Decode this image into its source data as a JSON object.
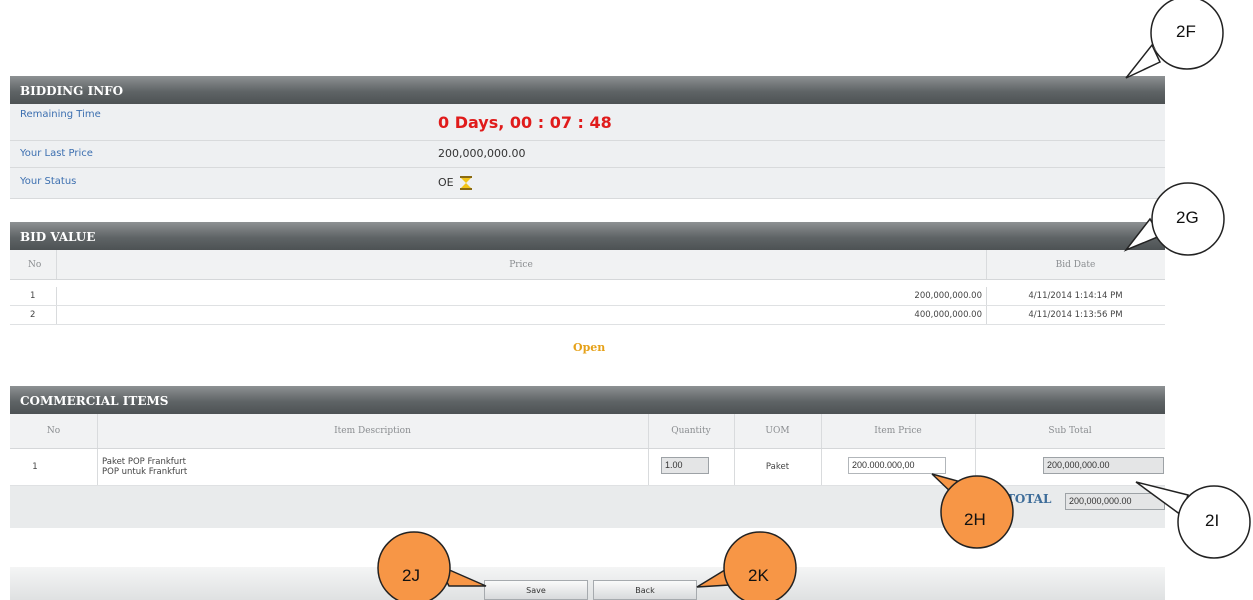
{
  "bidding_info": {
    "header": "BIDDING INFO",
    "remaining_time_label": "Remaining Time",
    "remaining_time_value": "0 Days, 00 : 07 : 48",
    "last_price_label": "Your Last Price",
    "last_price_value": "200,000,000.00",
    "status_label": "Your Status",
    "status_value": "OE"
  },
  "bid_value": {
    "header": "BID VALUE",
    "columns": [
      "No",
      "Price",
      "Bid Date"
    ],
    "rows": [
      {
        "no": "1",
        "price": "200,000,000.00",
        "date": "4/11/2014 1:14:14 PM"
      },
      {
        "no": "2",
        "price": "400,000,000.00",
        "date": "4/11/2014 1:13:56 PM"
      }
    ],
    "open_link": "Open"
  },
  "commercial_items": {
    "header": "COMMERCIAL ITEMS",
    "columns": [
      "No",
      "Item Description",
      "Quantity",
      "UOM",
      "Item Price",
      "Sub Total"
    ],
    "row": {
      "no": "1",
      "desc_line1": "Paket POP Frankfurt",
      "desc_line2": "POP untuk Frankfurt",
      "quantity": "1.00",
      "uom": "Paket",
      "item_price": "200.000.000,00",
      "sub_total": "200,000,000.00"
    },
    "total_label": "TOTAL",
    "total_value": "200,000,000.00"
  },
  "buttons": {
    "save": "Save",
    "back": "Back"
  },
  "callouts": {
    "c2f": "2F",
    "c2g": "2G",
    "c2h": "2H",
    "c2i": "2I",
    "c2j": "2J",
    "c2k": "2K"
  },
  "colors": {
    "callout_orange": "#F79646",
    "timer_red": "#E01B1B",
    "link_blue": "#3C6FB0",
    "open_orange": "#E6A118"
  }
}
